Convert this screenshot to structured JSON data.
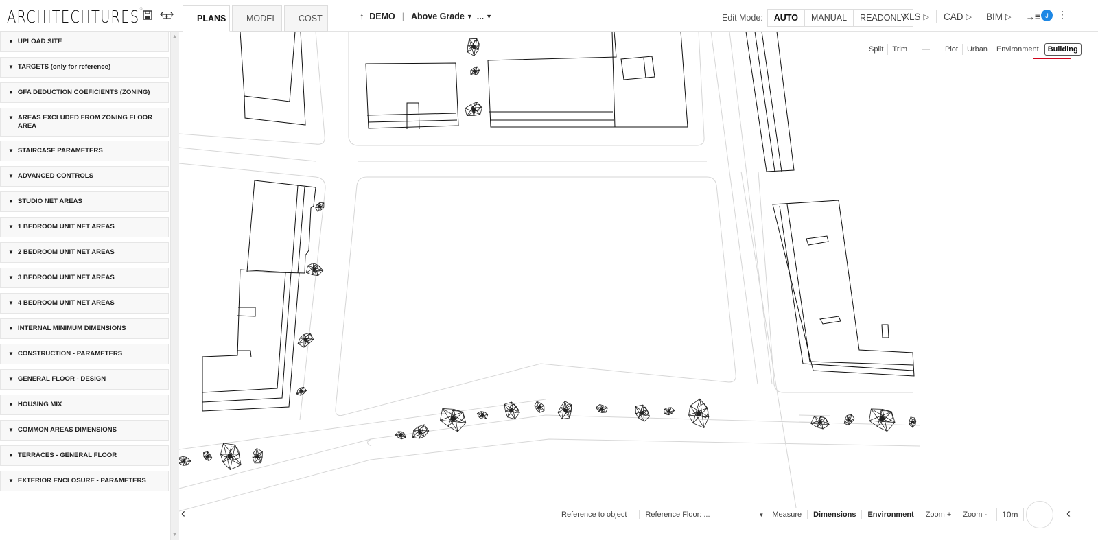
{
  "app": {
    "logo": "ARCHITECHTURES",
    "logo_mark": "®"
  },
  "toolbar": {
    "save_icon": "floppy-disk-icon",
    "undo_icon": "undo-icon",
    "redo_icon": "redo-icon"
  },
  "tabs": [
    {
      "label": "PLANS",
      "active": true
    },
    {
      "label": "MODEL",
      "active": false
    },
    {
      "label": "COST",
      "active": false
    }
  ],
  "breadcrumb": {
    "up_icon": "↑",
    "project": "DEMO",
    "separator": "|",
    "level": "Above Grade",
    "more": "...",
    "chevron": "⌄"
  },
  "edit_mode": {
    "label": "Edit Mode:",
    "options": [
      "AUTO",
      "MANUAL",
      "READONLY"
    ],
    "selected": "AUTO"
  },
  "exports": [
    {
      "label": "XLS",
      "icon": "▷"
    },
    {
      "label": "CAD",
      "icon": "▷"
    },
    {
      "label": "BIM",
      "icon": "▷"
    },
    {
      "label": "→≡",
      "icon": ""
    }
  ],
  "user": {
    "initial": "J",
    "menu_icon": "⋮"
  },
  "sidebar": {
    "panels": [
      "UPLOAD SITE",
      "TARGETS (only for reference)",
      "GFA DEDUCTION COEFICIENTS (ZONING)",
      "AREAS EXCLUDED FROM ZONING FLOOR AREA",
      "STAIRCASE PARAMETERS",
      "ADVANCED CONTROLS",
      "STUDIO NET AREAS",
      "1 BEDROOM UNIT NET AREAS",
      "2 BEDROOM UNIT NET AREAS",
      "3 BEDROOM UNIT NET AREAS",
      "4 BEDROOM UNIT NET AREAS",
      "INTERNAL MINIMUM DIMENSIONS",
      "CONSTRUCTION - PARAMETERS",
      "GENERAL FLOOR - DESIGN",
      "HOUSING MIX",
      "COMMON AREAS DIMENSIONS",
      "TERRACES - GENERAL FLOOR",
      "EXTERIOR ENCLOSURE - PARAMETERS"
    ],
    "chevron": "❯"
  },
  "layers": {
    "tools": [
      "Split",
      "Trim"
    ],
    "dash": "—",
    "views": [
      "Plot",
      "Urban",
      "Environment",
      "Building"
    ],
    "active": "Building"
  },
  "bottom": {
    "reference_object": "Reference to object",
    "reference_floor": "Reference Floor: ...",
    "select_chevron": "⌄",
    "measure": "Measure",
    "dimensions": "Dimensions",
    "environment": "Environment",
    "zoom_in": "Zoom +",
    "zoom_out": "Zoom -",
    "scale": "10m"
  },
  "nav": {
    "collapse_left": "‹",
    "collapse_right": "‹"
  },
  "colors": {
    "accent_underline": "#d0021b",
    "avatar": "#1e88e5"
  }
}
